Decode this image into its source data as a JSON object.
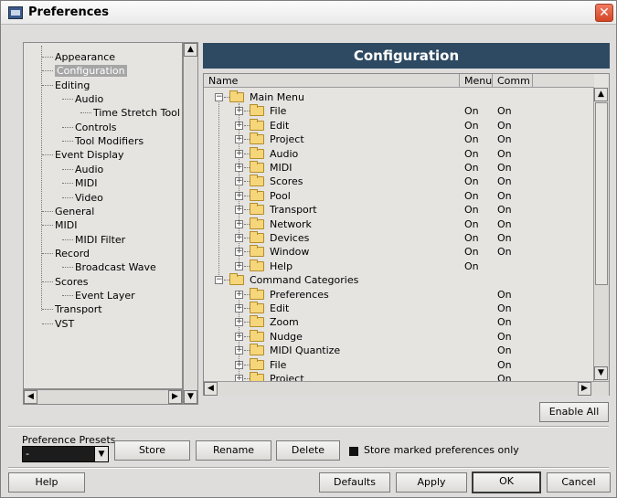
{
  "window": {
    "title": "Preferences",
    "close_symbol": "✕"
  },
  "tree": {
    "items": [
      {
        "label": "Appearance",
        "level": 1
      },
      {
        "label": "Configuration",
        "level": 1,
        "selected": true
      },
      {
        "label": "Editing",
        "level": 1
      },
      {
        "label": "Audio",
        "level": 2
      },
      {
        "label": "Time Stretch Tool",
        "level": 3
      },
      {
        "label": "Controls",
        "level": 2
      },
      {
        "label": "Tool Modifiers",
        "level": 2
      },
      {
        "label": "Event Display",
        "level": 1
      },
      {
        "label": "Audio",
        "level": 2
      },
      {
        "label": "MIDI",
        "level": 2
      },
      {
        "label": "Video",
        "level": 2
      },
      {
        "label": "General",
        "level": 1
      },
      {
        "label": "MIDI",
        "level": 1
      },
      {
        "label": "MIDI Filter",
        "level": 2
      },
      {
        "label": "Record",
        "level": 1
      },
      {
        "label": "Broadcast Wave",
        "level": 2
      },
      {
        "label": "Scores",
        "level": 1
      },
      {
        "label": "Event Layer",
        "level": 2
      },
      {
        "label": "Transport",
        "level": 1
      },
      {
        "label": "VST",
        "level": 1
      }
    ]
  },
  "config": {
    "header": "Configuration",
    "columns": {
      "name": "Name",
      "menu": "Menu",
      "comm": "Comm"
    },
    "rows": [
      {
        "label": "Main Menu",
        "level": 0,
        "expander": "−",
        "menu": "",
        "comm": ""
      },
      {
        "label": "File",
        "level": 1,
        "expander": "+",
        "menu": "On",
        "comm": "On"
      },
      {
        "label": "Edit",
        "level": 1,
        "expander": "+",
        "menu": "On",
        "comm": "On"
      },
      {
        "label": "Project",
        "level": 1,
        "expander": "+",
        "menu": "On",
        "comm": "On"
      },
      {
        "label": "Audio",
        "level": 1,
        "expander": "+",
        "menu": "On",
        "comm": "On"
      },
      {
        "label": "MIDI",
        "level": 1,
        "expander": "+",
        "menu": "On",
        "comm": "On"
      },
      {
        "label": "Scores",
        "level": 1,
        "expander": "+",
        "menu": "On",
        "comm": "On"
      },
      {
        "label": "Pool",
        "level": 1,
        "expander": "+",
        "menu": "On",
        "comm": "On"
      },
      {
        "label": "Transport",
        "level": 1,
        "expander": "+",
        "menu": "On",
        "comm": "On"
      },
      {
        "label": "Network",
        "level": 1,
        "expander": "+",
        "menu": "On",
        "comm": "On"
      },
      {
        "label": "Devices",
        "level": 1,
        "expander": "+",
        "menu": "On",
        "comm": "On"
      },
      {
        "label": "Window",
        "level": 1,
        "expander": "+",
        "menu": "On",
        "comm": "On"
      },
      {
        "label": "Help",
        "level": 1,
        "expander": "+",
        "menu": "On",
        "comm": ""
      },
      {
        "label": "Command Categories",
        "level": 0,
        "expander": "−",
        "menu": "",
        "comm": ""
      },
      {
        "label": "Preferences",
        "level": 1,
        "expander": "+",
        "menu": "",
        "comm": "On"
      },
      {
        "label": "Edit",
        "level": 1,
        "expander": "+",
        "menu": "",
        "comm": "On"
      },
      {
        "label": "Zoom",
        "level": 1,
        "expander": "+",
        "menu": "",
        "comm": "On"
      },
      {
        "label": "Nudge",
        "level": 1,
        "expander": "+",
        "menu": "",
        "comm": "On"
      },
      {
        "label": "MIDI Quantize",
        "level": 1,
        "expander": "+",
        "menu": "",
        "comm": "On"
      },
      {
        "label": "File",
        "level": 1,
        "expander": "+",
        "menu": "",
        "comm": "On"
      },
      {
        "label": "Project",
        "level": 1,
        "expander": "+",
        "menu": "",
        "comm": "On"
      }
    ],
    "enable_all": "Enable All"
  },
  "scroll": {
    "up": "▲",
    "down": "▼",
    "left": "◀",
    "right": "▶"
  },
  "presets": {
    "label": "Preference Presets",
    "value": "-",
    "store": "Store",
    "rename": "Rename",
    "delete": "Delete",
    "store_marked": "Store marked preferences only"
  },
  "footer": {
    "help": "Help",
    "defaults": "Defaults",
    "apply": "Apply",
    "ok": "OK",
    "cancel": "Cancel"
  },
  "colors": {
    "header_bg": "#2e4a62",
    "selection": "#a6a6a6",
    "folder": "#f6d67a"
  }
}
